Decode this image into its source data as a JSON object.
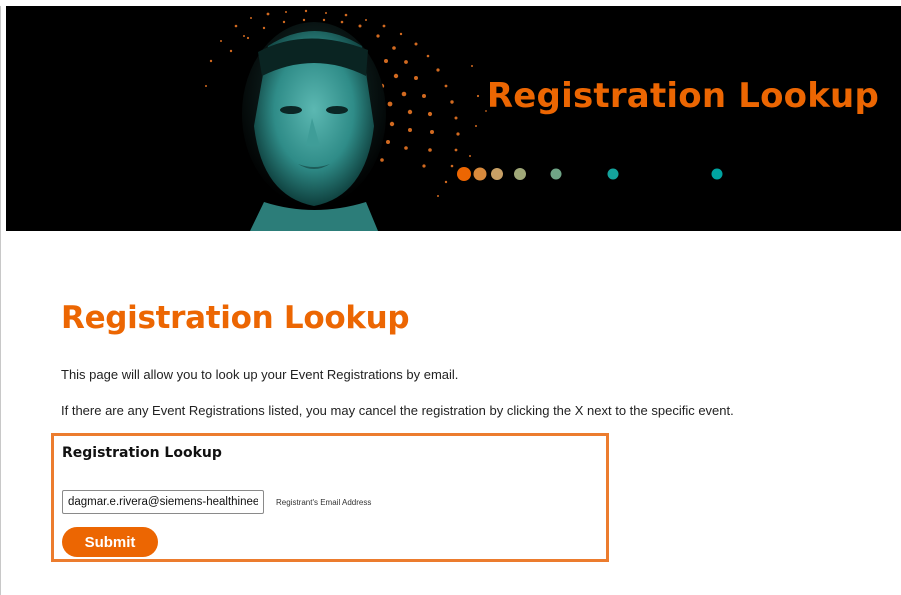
{
  "hero": {
    "title": "Registration Lookup",
    "dot_colors": [
      "#ec6602",
      "#d98a3c",
      "#c8a066",
      "#a0a878",
      "#6fa486",
      "#14a39c",
      "#00a3a0"
    ]
  },
  "main": {
    "title": "Registration Lookup",
    "intro": "This page will allow you to look up your Event Registrations by email.",
    "instructions": "If there are any Event Registrations listed, you may cancel the registration by clicking the X next to the specific event."
  },
  "lookup_form": {
    "heading": "Registration Lookup",
    "email_value": "dagmar.e.rivera@siemens-healthineers.com",
    "email_label": "Registrant's Email Address",
    "submit_label": "Submit"
  },
  "colors": {
    "accent": "#ec6602",
    "box_border": "#ec7c2e"
  }
}
